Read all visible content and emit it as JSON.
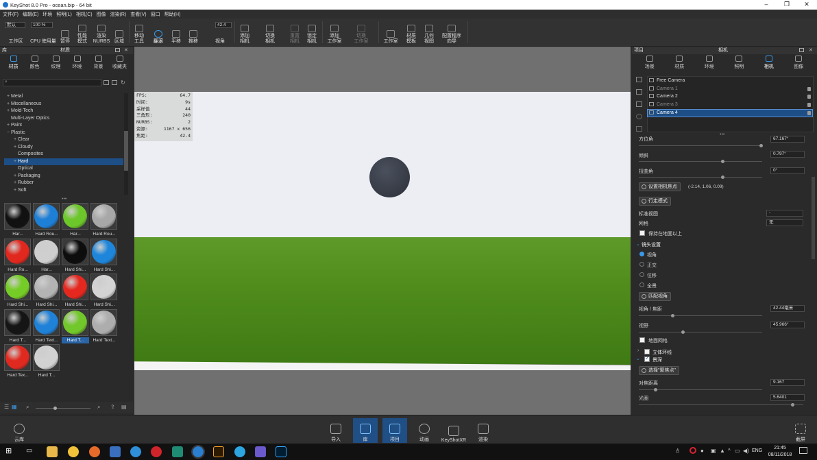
{
  "titlebar": {
    "title": "KeyShot 8.0 Pro  -  ocean.bip  -  64 bit",
    "minimize": "–",
    "maximize": "❐",
    "close": "✕"
  },
  "menu": [
    "文件(F)",
    "编辑(E)",
    "环境",
    "照明(L)",
    "相机(C)",
    "图像",
    "渲染(R)",
    "查看(V)",
    "窗口",
    "帮助(H)"
  ],
  "toolbar": {
    "preset_value": "默认",
    "zoom_value": "100 %",
    "fov_value": "42.4",
    "items": {
      "workspace": "工作区",
      "cpu": "CPU 使用量",
      "pause": "暂停",
      "performance": "性能\n模式",
      "nurbs": "渲染\nNURBS",
      "region": "区域",
      "move_tool": "移动\n工具",
      "tumble": "翻滚",
      "pan": "平移",
      "dolly": "推移",
      "perspective": "视角",
      "add_camera": "添加\n相机",
      "switch_camera": "切换\n相机",
      "reset_camera": "重置\n相机",
      "lock_camera": "锁定\n相机",
      "add_studio": "添加\n工作室",
      "switch_studio": "切换\n工作室",
      "studio": "工作室",
      "material_template": "材质\n模板",
      "geometry_view": "几何\n视图",
      "config_wizard": "配置程序\n向导"
    }
  },
  "library": {
    "panel_left_title": "库",
    "panel_title": "材质",
    "tabs": [
      "材质",
      "颜色",
      "纹理",
      "环境",
      "背景",
      "收藏夹"
    ],
    "search_placeholder": "",
    "tree": [
      {
        "label": "Metal",
        "exp": "+",
        "indent": 1
      },
      {
        "label": "Miscellaneous",
        "exp": "+",
        "indent": 1
      },
      {
        "label": "Mold-Tech",
        "exp": "+",
        "indent": 1
      },
      {
        "label": "Multi-Layer Optics",
        "exp": "",
        "indent": 1
      },
      {
        "label": "Paint",
        "exp": "+",
        "indent": 1
      },
      {
        "label": "Plastic",
        "exp": "−",
        "indent": 1
      },
      {
        "label": "Clear",
        "exp": "+",
        "indent": 2
      },
      {
        "label": "Cloudy",
        "exp": "+",
        "indent": 2
      },
      {
        "label": "Composites",
        "exp": "",
        "indent": 2
      },
      {
        "label": "Hard",
        "exp": "+",
        "indent": 2,
        "selected": true
      },
      {
        "label": "Optical",
        "exp": "",
        "indent": 2
      },
      {
        "label": "Packaging",
        "exp": "+",
        "indent": 2
      },
      {
        "label": "Rubber",
        "exp": "+",
        "indent": 2
      },
      {
        "label": "Soft",
        "exp": "+",
        "indent": 2
      }
    ],
    "materials": [
      {
        "label": "Har...",
        "color": "#111111"
      },
      {
        "label": "Hard Rou...",
        "color": "#1e7fd6"
      },
      {
        "label": "Har...",
        "color": "#6cc72a"
      },
      {
        "label": "Hard Rou...",
        "color": "#a8a8a8"
      },
      {
        "label": "Hard Ro...",
        "color": "#e0281e"
      },
      {
        "label": "Har...",
        "color": "#cfcfcf"
      },
      {
        "label": "Hard Shi...",
        "color": "#0d0d0d"
      },
      {
        "label": "Hard Shi...",
        "color": "#1e86da"
      },
      {
        "label": "Hard Shi...",
        "color": "#76cc26"
      },
      {
        "label": "Hard Shi...",
        "color": "#b4b4b4"
      },
      {
        "label": "Hard Shi...",
        "color": "#e5281f"
      },
      {
        "label": "Hard Shi...",
        "color": "#d4d4d4"
      },
      {
        "label": "Hard T...",
        "color": "#151515"
      },
      {
        "label": "Hard Text...",
        "color": "#1f82d8"
      },
      {
        "label": "Hard T...",
        "color": "#72c82a",
        "selected": true
      },
      {
        "label": "Hard Text...",
        "color": "#adadad"
      },
      {
        "label": "Hard Tex...",
        "color": "#e02a20"
      },
      {
        "label": "Hard T...",
        "color": "#d2d2d2"
      }
    ]
  },
  "viewport": {
    "stats": [
      {
        "k": "FPS:",
        "v": "64.7"
      },
      {
        "k": "时间:",
        "v": "9s"
      },
      {
        "k": "采样值",
        "v": "44"
      },
      {
        "k": "三角形:",
        "v": "240"
      },
      {
        "k": "NURBS:",
        "v": "2"
      },
      {
        "k": "资源:",
        "v": "1167 x 656"
      },
      {
        "k": "焦距:",
        "v": "42.4"
      }
    ],
    "colors": {
      "sky": "#eceef3",
      "ground": "#4f8c1c",
      "sphere": "#383d48"
    }
  },
  "project": {
    "panel_left_title": "项目",
    "panel_title": "相机",
    "tabs": [
      "场景",
      "材质",
      "环境",
      "照明",
      "相机",
      "图像"
    ],
    "cameras": [
      {
        "label": "Free Camera",
        "state": "normal"
      },
      {
        "label": "Camera 1",
        "state": "dim"
      },
      {
        "label": "Camera 2",
        "state": "normal"
      },
      {
        "label": "Camera 3",
        "state": "dim"
      },
      {
        "label": "Camera 4",
        "state": "selected"
      }
    ],
    "props": {
      "azimuth_label": "方位角",
      "azimuth_value": "67.167°",
      "inclination_label": "倾斜",
      "inclination_value": "0.797°",
      "twist_label": "扭曲角",
      "twist_value": "0°",
      "set_focus_btn": "设置相机焦点",
      "focus_point": "(-2.14, 1.06, 0.09)",
      "walk_mode_btn": "行走模式",
      "standard_view_label": "标准视图",
      "standard_view_value": "-",
      "grid_label": "网格",
      "grid_value": "无",
      "keep_above_ground": "保持在地面以上",
      "lens_section": "镜头设置",
      "lens_perspective": "视角",
      "lens_ortho": "正交",
      "lens_shift": "位移",
      "lens_panorama": "全景",
      "match_persp_btn": "匹配视角",
      "focal_label": "视角 / 焦距",
      "focal_value": "42.44毫米",
      "fov_label": "视野",
      "fov_value": "45.966°",
      "ground_grid": "地面网格",
      "stereo": "立体环线",
      "dof": "景深",
      "pick_focus_btn": "选择\"聚焦点\"",
      "focus_dist_label": "对焦距离",
      "focus_dist_value": "9.167",
      "aperture_label": "光圈",
      "aperture_value": "5.6401"
    }
  },
  "dock": {
    "cloud": "云库",
    "import": "导入",
    "library": "库",
    "project": "项目",
    "animation": "动画",
    "keyshotxr": "KeyShotXR",
    "render": "渲染",
    "screenshot": "截屏"
  },
  "taskbar": {
    "lang": "ENG",
    "time": "21:45",
    "date": "08/11/2018"
  }
}
